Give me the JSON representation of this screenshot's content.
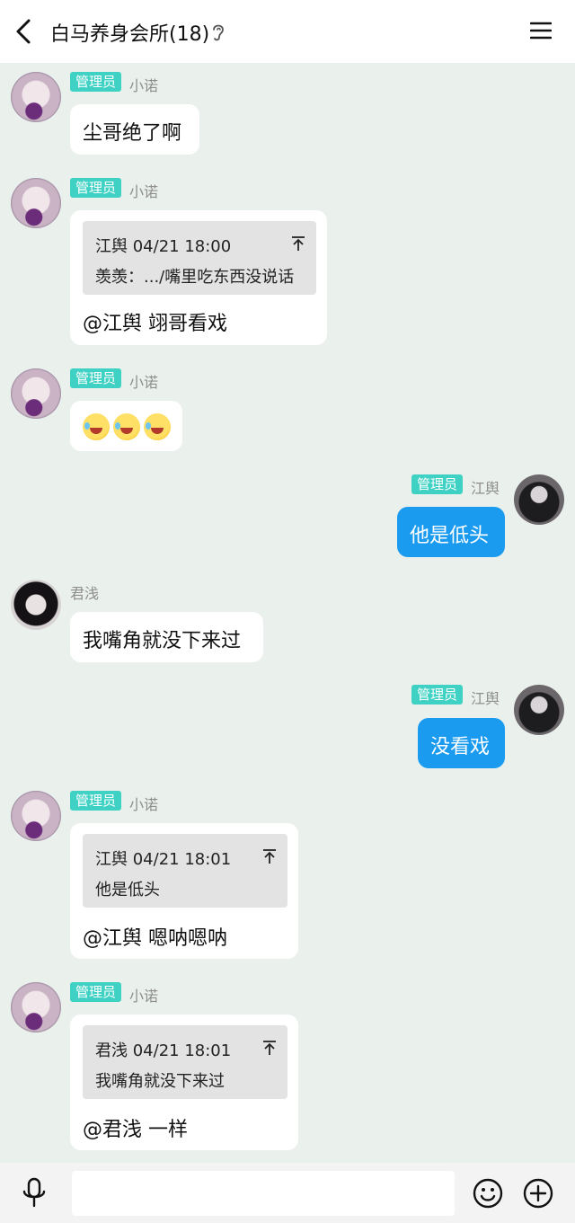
{
  "header": {
    "title": "白马养身会所(18)"
  },
  "messages": [
    {
      "sender": "小诺",
      "badge": "管理员",
      "text": "尘哥绝了啊"
    },
    {
      "sender": "小诺",
      "badge": "管理员",
      "quote": {
        "head": "江舆 04/21 18:00",
        "body": "羡羡：.../嘴里吃东西没说话"
      },
      "text": "@江舆 翊哥看戏"
    },
    {
      "sender": "小诺",
      "badge": "管理员",
      "emoji": [
        "face-with-tears-of-joy-icon",
        "face-with-tears-of-joy-icon",
        "face-with-tears-of-joy-icon"
      ]
    },
    {
      "sender": "江舆",
      "badge": "管理员",
      "text": "他是低头"
    },
    {
      "sender": "君浅",
      "text": "我嘴角就没下来过"
    },
    {
      "sender": "江舆",
      "badge": "管理员",
      "text": "没看戏"
    },
    {
      "sender": "小诺",
      "badge": "管理员",
      "quote": {
        "head": "江舆 04/21 18:01",
        "body": "他是低头"
      },
      "text": "@江舆 嗯呐嗯呐"
    },
    {
      "sender": "小诺",
      "badge": "管理员",
      "quote": {
        "head": "君浅 04/21 18:01",
        "body": "我嘴角就没下来过"
      },
      "text": "@君浅 一样"
    }
  ],
  "colors": {
    "background": "#eaf0ec",
    "badge": "#3fd1c3",
    "my_bubble": "#1a9bf0"
  }
}
